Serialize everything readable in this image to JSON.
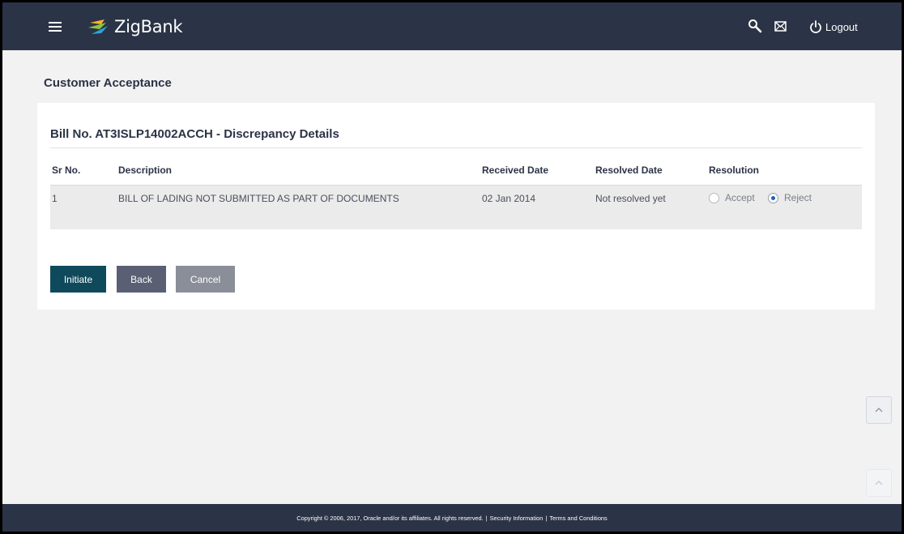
{
  "header": {
    "brand_name": "ZigBank",
    "logout_label": "Logout",
    "icons": [
      "menu-icon",
      "search-icon",
      "mail-icon",
      "power-icon"
    ]
  },
  "page": {
    "title": "Customer Acceptance"
  },
  "bill": {
    "title": "Bill No. AT3ISLP14002ACCH - Discrepancy Details",
    "columns": [
      "Sr No.",
      "Description",
      "Received Date",
      "Resolved Date",
      "Resolution"
    ],
    "rows": [
      {
        "sr_no": "1",
        "description": "BILL OF LADING NOT SUBMITTED AS PART OF DOCUMENTS",
        "received_date": "02 Jan 2014",
        "resolved_date": "Not resolved yet",
        "resolution_options": [
          "Accept",
          "Reject"
        ],
        "resolution_selected": "Reject"
      }
    ]
  },
  "actions": {
    "initiate_label": "Initiate",
    "back_label": "Back",
    "cancel_label": "Cancel"
  },
  "footer": {
    "copyright": "Copyright © 2006, 2017, Oracle and/or its affiliates. All rights reserved.",
    "separator": "|",
    "security_link": "Security Information",
    "terms_link": "Terms and Conditions"
  },
  "colors": {
    "header_bg": "#2b3346",
    "initiate_bg": "#0f4a5c",
    "back_bg": "#5a5f73",
    "cancel_bg": "#8a8e99",
    "radio_selected": "#1f5fbf"
  }
}
